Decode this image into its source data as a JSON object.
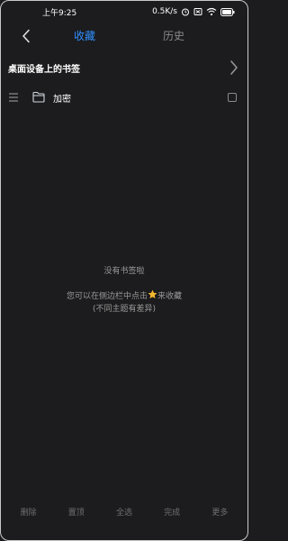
{
  "status_bar": {
    "time": "上午9:25",
    "network_speed": "0.5K/s",
    "icons": [
      "alarm-icon",
      "sim-off-icon",
      "wifi-icon",
      "battery-icon"
    ]
  },
  "header": {
    "tabs": [
      {
        "label": "收藏",
        "active": true
      },
      {
        "label": "历史",
        "active": false
      }
    ]
  },
  "desktop_bookmarks": {
    "label": "桌面设备上的书签"
  },
  "folders": [
    {
      "label": "加密"
    }
  ],
  "empty_state": {
    "title": "没有书签啦",
    "hint_before": "您可以在侧边栏中点击",
    "hint_after": "来收藏",
    "hint_note": "(不同主题有差异)"
  },
  "toolbar": {
    "delete_label": "删除",
    "pin_label": "置顶",
    "select_all_label": "全选",
    "done_label": "完成",
    "more_label": "更多"
  },
  "colors": {
    "background": "#1c1c1e",
    "accent": "#2f8fff",
    "star": "#f5b82e"
  }
}
